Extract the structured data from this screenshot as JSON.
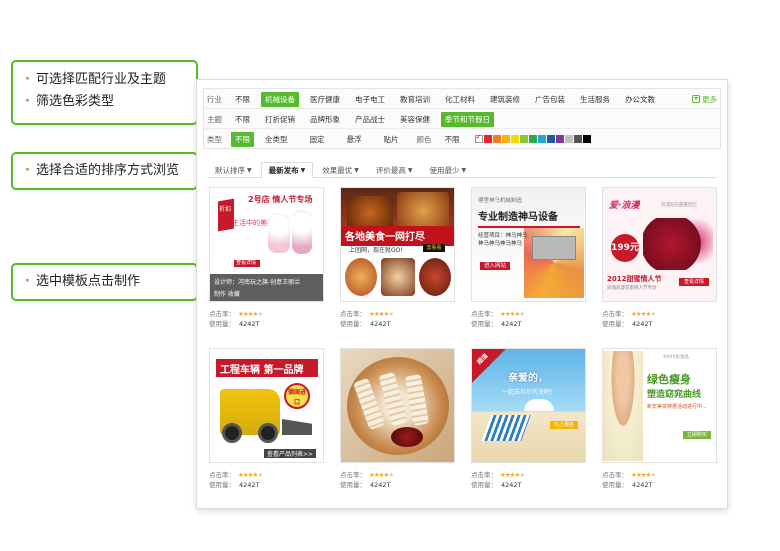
{
  "callouts": [
    {
      "lines": [
        "可选择匹配行业及主题",
        "筛选色彩类型"
      ]
    },
    {
      "lines": [
        "选择合适的排序方式浏览"
      ]
    },
    {
      "lines": [
        "选中模板点击制作"
      ]
    }
  ],
  "filters": {
    "industry": {
      "label": "行业",
      "options": [
        "不限",
        "机械设备",
        "医疗健康",
        "电子电工",
        "教育培训",
        "化工材料",
        "建筑装修",
        "广告包装",
        "生活服务",
        "办公文教"
      ],
      "selected": "机械设备",
      "more": "更多"
    },
    "theme": {
      "label": "主题",
      "options": [
        "不限",
        "打折促销",
        "品牌形象",
        "产品战士",
        "美容保健",
        "季节和节假日"
      ],
      "selected": "季节和节假日"
    },
    "type": {
      "label": "类型",
      "options": [
        "不限",
        "全类型",
        "固定",
        "悬浮",
        "贴片"
      ],
      "selected": "不限"
    },
    "color": {
      "label": "颜色",
      "any": "不限",
      "swatches": [
        "#ffffff",
        "#e8262d",
        "#f57a20",
        "#f7b500",
        "#f5d90a",
        "#8cc63f",
        "#2aa84a",
        "#24a3d8",
        "#1d5aa8",
        "#7a3b96",
        "#c0c0c0",
        "#555555",
        "#000000"
      ]
    }
  },
  "sort": {
    "tabs": [
      "默认排序",
      "最新发布",
      "效果最优",
      "评价最高",
      "使用最少"
    ],
    "active": "最新发布"
  },
  "templates": [
    {
      "art": {
        "tag": "折扣",
        "title": "2号店 情人节专场",
        "sub": "生活中的美丽",
        "btn": "查看详情",
        "ov1": "设计师：河南玩之旗-创意王丽兰",
        "ov2": "制作    收藏"
      },
      "clicks_label": "点击率：",
      "stars": 4,
      "uses_label": "使用量：",
      "uses": "4242T"
    },
    {
      "art": {
        "title": "各地美食一网打尽",
        "sub": "上团网，现在就GO!",
        "go": "去看看"
      },
      "clicks_label": "点击率：",
      "stars": 4,
      "uses_label": "使用量：",
      "uses": "4242T"
    },
    {
      "art": {
        "small": "哪里神马机械制造",
        "title": "专业制造神马设备",
        "list": "经营项目：神马神马神马神马神马神马",
        "btn": "进入网站"
      },
      "clicks_label": "点击率：",
      "stars": 4,
      "uses_label": "使用量：",
      "uses": "4242T"
    },
    {
      "art": {
        "script": "爱·浪漫",
        "small": "浪漫钻石甜蜜回忆",
        "price": "199元",
        "bottom": "2012甜蜜情人节",
        "bottom2": "玫瑰浪漫花束情人节专场",
        "btn": "查看详情"
      },
      "clicks_label": "点击率：",
      "stars": 4,
      "uses_label": "使用量：",
      "uses": "4242T"
    },
    {
      "art": {
        "title": "工程车辆 第一品牌",
        "badge": "德国进口",
        "foot": "查看产品列表>>"
      },
      "clicks_label": "点击率：",
      "stars": 4,
      "uses_label": "使用量：",
      "uses": "4242T"
    },
    {
      "art": {},
      "clicks_label": "点击率：",
      "stars": 4,
      "uses_label": "使用量：",
      "uses": "4242T"
    },
    {
      "art": {
        "tag": "超值",
        "title": "亲爱的，",
        "sub": "一起去马尔代夫吧！",
        "btn": "马上报名"
      },
      "clicks_label": "点击率：",
      "stars": 4,
      "uses_label": "使用量：",
      "uses": "4242T"
    },
    {
      "art": {
        "small": "XXXX化妆品",
        "title1": "绿色瘦身",
        "title2": "塑造窈窕曲线",
        "line": "新年美体特惠活动进行中...",
        "btn": "立即购买"
      },
      "clicks_label": "点击率：",
      "stars": 4,
      "uses_label": "使用量：",
      "uses": "4242T"
    }
  ],
  "colors": {
    "accent": "#58b92f",
    "brand_red": "#c7192a",
    "star": "#f5a623"
  }
}
